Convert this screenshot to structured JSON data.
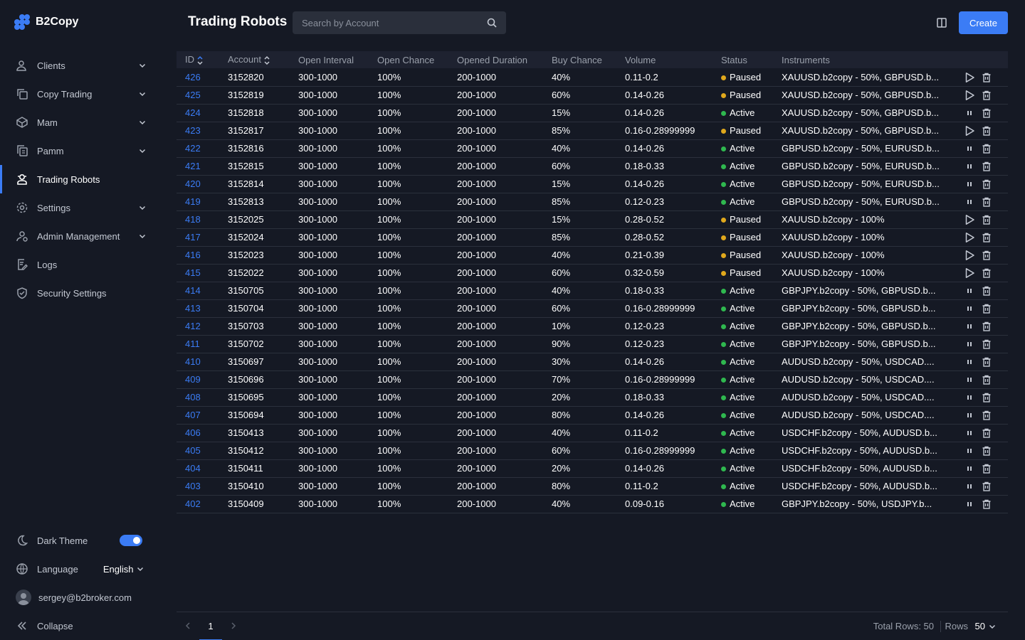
{
  "app": {
    "name": "B2Copy"
  },
  "sidebar": {
    "items": [
      {
        "label": "Clients",
        "icon": "clients-icon",
        "expandable": true
      },
      {
        "label": "Copy Trading",
        "icon": "copy-icon",
        "expandable": true
      },
      {
        "label": "Mam",
        "icon": "box-icon",
        "expandable": true
      },
      {
        "label": "Pamm",
        "icon": "pamm-icon",
        "expandable": true
      },
      {
        "label": "Trading Robots",
        "icon": "robot-icon",
        "expandable": false,
        "active": true
      },
      {
        "label": "Settings",
        "icon": "gear-icon",
        "expandable": true
      },
      {
        "label": "Admin Management",
        "icon": "admin-icon",
        "expandable": true
      },
      {
        "label": "Logs",
        "icon": "logs-icon",
        "expandable": false
      },
      {
        "label": "Security Settings",
        "icon": "shield-icon",
        "expandable": false
      }
    ],
    "dark_theme_label": "Dark Theme",
    "dark_theme_on": true,
    "language_label": "Language",
    "language_value": "English",
    "user_email": "sergey@b2broker.com",
    "collapse_label": "Collapse"
  },
  "header": {
    "title": "Trading Robots",
    "search_placeholder": "Search by Account",
    "create_label": "Create"
  },
  "table": {
    "columns": [
      "ID",
      "Account",
      "Open Interval",
      "Open Chance",
      "Opened Duration",
      "Buy Chance",
      "Volume",
      "Status",
      "Instruments"
    ],
    "rows": [
      [
        "426",
        "3152820",
        "300-1000",
        "100%",
        "200-1000",
        "40%",
        "0.11-0.2",
        "Paused",
        "XAUUSD.b2copy - 50%, GBPUSD.b..."
      ],
      [
        "425",
        "3152819",
        "300-1000",
        "100%",
        "200-1000",
        "60%",
        "0.14-0.26",
        "Paused",
        "XAUUSD.b2copy - 50%, GBPUSD.b..."
      ],
      [
        "424",
        "3152818",
        "300-1000",
        "100%",
        "200-1000",
        "15%",
        "0.14-0.26",
        "Active",
        "XAUUSD.b2copy - 50%, GBPUSD.b..."
      ],
      [
        "423",
        "3152817",
        "300-1000",
        "100%",
        "200-1000",
        "85%",
        "0.16-0.28999999",
        "Paused",
        "XAUUSD.b2copy - 50%, GBPUSD.b..."
      ],
      [
        "422",
        "3152816",
        "300-1000",
        "100%",
        "200-1000",
        "40%",
        "0.14-0.26",
        "Active",
        "GBPUSD.b2copy - 50%, EURUSD.b..."
      ],
      [
        "421",
        "3152815",
        "300-1000",
        "100%",
        "200-1000",
        "60%",
        "0.18-0.33",
        "Active",
        "GBPUSD.b2copy - 50%, EURUSD.b..."
      ],
      [
        "420",
        "3152814",
        "300-1000",
        "100%",
        "200-1000",
        "15%",
        "0.14-0.26",
        "Active",
        "GBPUSD.b2copy - 50%, EURUSD.b..."
      ],
      [
        "419",
        "3152813",
        "300-1000",
        "100%",
        "200-1000",
        "85%",
        "0.12-0.23",
        "Active",
        "GBPUSD.b2copy - 50%, EURUSD.b..."
      ],
      [
        "418",
        "3152025",
        "300-1000",
        "100%",
        "200-1000",
        "15%",
        "0.28-0.52",
        "Paused",
        "XAUUSD.b2copy - 100%"
      ],
      [
        "417",
        "3152024",
        "300-1000",
        "100%",
        "200-1000",
        "85%",
        "0.28-0.52",
        "Paused",
        "XAUUSD.b2copy - 100%"
      ],
      [
        "416",
        "3152023",
        "300-1000",
        "100%",
        "200-1000",
        "40%",
        "0.21-0.39",
        "Paused",
        "XAUUSD.b2copy - 100%"
      ],
      [
        "415",
        "3152022",
        "300-1000",
        "100%",
        "200-1000",
        "60%",
        "0.32-0.59",
        "Paused",
        "XAUUSD.b2copy - 100%"
      ],
      [
        "414",
        "3150705",
        "300-1000",
        "100%",
        "200-1000",
        "40%",
        "0.18-0.33",
        "Active",
        "GBPJPY.b2copy - 50%, GBPUSD.b..."
      ],
      [
        "413",
        "3150704",
        "300-1000",
        "100%",
        "200-1000",
        "60%",
        "0.16-0.28999999",
        "Active",
        "GBPJPY.b2copy - 50%, GBPUSD.b..."
      ],
      [
        "412",
        "3150703",
        "300-1000",
        "100%",
        "200-1000",
        "10%",
        "0.12-0.23",
        "Active",
        "GBPJPY.b2copy - 50%, GBPUSD.b..."
      ],
      [
        "411",
        "3150702",
        "300-1000",
        "100%",
        "200-1000",
        "90%",
        "0.12-0.23",
        "Active",
        "GBPJPY.b2copy - 50%, GBPUSD.b..."
      ],
      [
        "410",
        "3150697",
        "300-1000",
        "100%",
        "200-1000",
        "30%",
        "0.14-0.26",
        "Active",
        "AUDUSD.b2copy - 50%, USDCAD...."
      ],
      [
        "409",
        "3150696",
        "300-1000",
        "100%",
        "200-1000",
        "70%",
        "0.16-0.28999999",
        "Active",
        "AUDUSD.b2copy - 50%, USDCAD...."
      ],
      [
        "408",
        "3150695",
        "300-1000",
        "100%",
        "200-1000",
        "20%",
        "0.18-0.33",
        "Active",
        "AUDUSD.b2copy - 50%, USDCAD...."
      ],
      [
        "407",
        "3150694",
        "300-1000",
        "100%",
        "200-1000",
        "80%",
        "0.14-0.26",
        "Active",
        "AUDUSD.b2copy - 50%, USDCAD...."
      ],
      [
        "406",
        "3150413",
        "300-1000",
        "100%",
        "200-1000",
        "40%",
        "0.11-0.2",
        "Active",
        "USDCHF.b2copy - 50%, AUDUSD.b..."
      ],
      [
        "405",
        "3150412",
        "300-1000",
        "100%",
        "200-1000",
        "60%",
        "0.16-0.28999999",
        "Active",
        "USDCHF.b2copy - 50%, AUDUSD.b..."
      ],
      [
        "404",
        "3150411",
        "300-1000",
        "100%",
        "200-1000",
        "20%",
        "0.14-0.26",
        "Active",
        "USDCHF.b2copy - 50%, AUDUSD.b..."
      ],
      [
        "403",
        "3150410",
        "300-1000",
        "100%",
        "200-1000",
        "80%",
        "0.11-0.2",
        "Active",
        "USDCHF.b2copy - 50%, AUDUSD.b..."
      ],
      [
        "402",
        "3150409",
        "300-1000",
        "100%",
        "200-1000",
        "40%",
        "0.09-0.16",
        "Active",
        "GBPJPY.b2copy - 50%, USDJPY.b..."
      ]
    ]
  },
  "pagination": {
    "current_page": "1",
    "total_rows_label": "Total Rows: 50",
    "rows_label": "Rows",
    "rows_value": "50"
  },
  "colors": {
    "accent": "#3b7cf5",
    "paused": "#e0a81c",
    "active": "#2fb84f",
    "background": "#151924"
  }
}
